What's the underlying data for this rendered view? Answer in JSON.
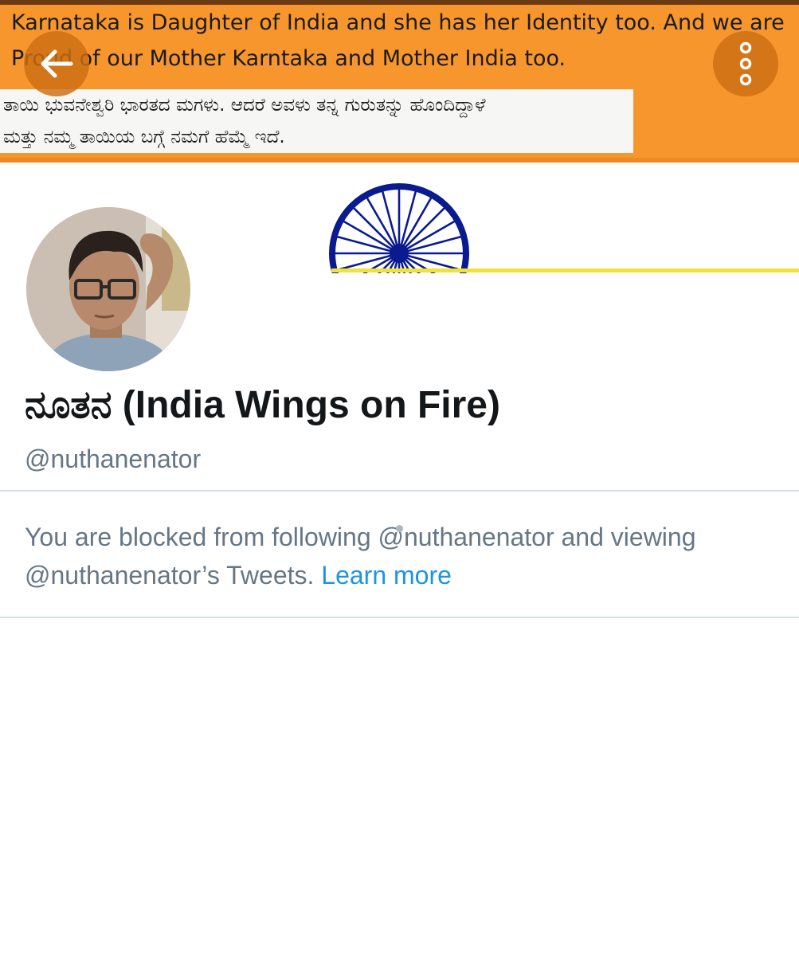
{
  "banner": {
    "english_text": "Karnataka is Daughter of India and she has her Identity too. And we are Proud of our Mother Karntaka and Mother India too.",
    "kannada_text": "ತಾಯಿ ಭುವನೇಶ್ವರಿ ಭಾರತದ ಮಗಳು. ಆದರೆ ಅವಳು ತನ್ನ ಗುರುತನ್ನು ಹೊಂದಿದ್ದಾಳೆ\n ಮತ್ತು ನಮ್ಮ ತಾಯಿಯ ಬಗ್ಗೆ ನಮಗೆ ಹೆಮ್ಮೆ ಇದೆ."
  },
  "header": {
    "back_icon": "arrow-left-icon",
    "more_icon": "more-vertical-icon"
  },
  "profile": {
    "display_name": "ನೂತನ (India Wings on Fire)",
    "handle": "@nuthanenator"
  },
  "blocked": {
    "message": "You are blocked from following @nuthanenator and viewing @nuthanenator’s Tweets.",
    "learn_more": "Learn more"
  },
  "colors": {
    "saffron": "#f7962c",
    "chakra_blue": "#0a1b8f",
    "link_blue": "#1b95e0",
    "text_primary": "#14171a",
    "text_secondary": "#657786",
    "divider": "#d8e0e6"
  }
}
